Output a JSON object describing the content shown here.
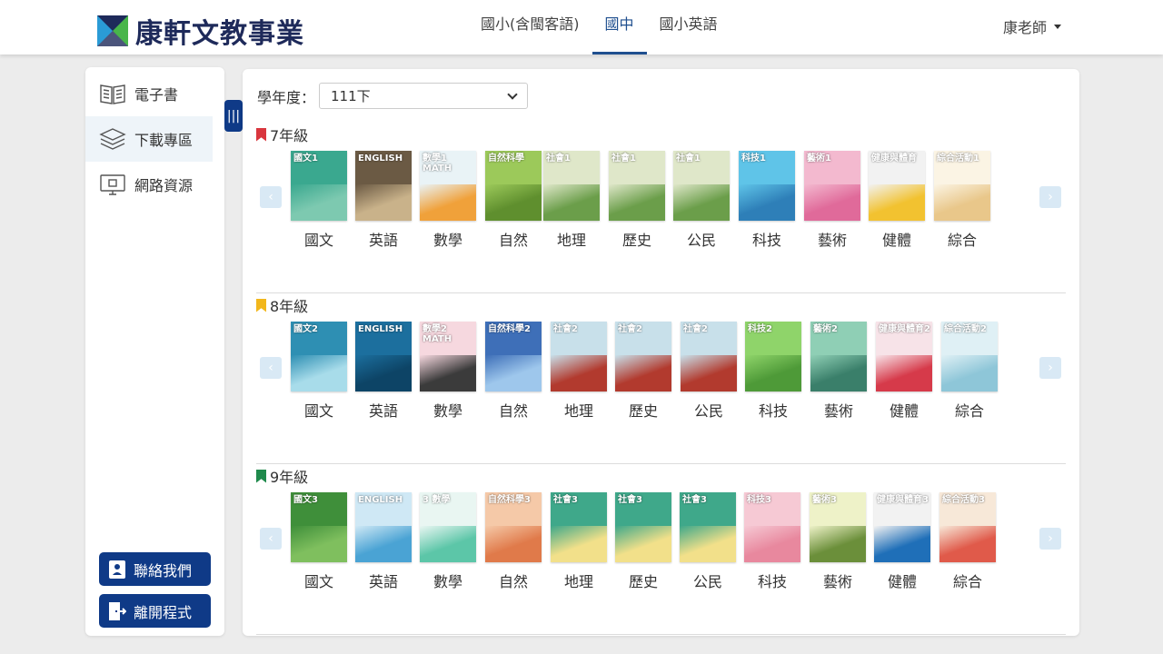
{
  "brand": {
    "name": "康軒文教事業"
  },
  "nav": {
    "items": [
      "國小(含閩客語)",
      "國中",
      "國小英語"
    ],
    "active": 1
  },
  "user": {
    "name": "康老師"
  },
  "sidebar": {
    "items": [
      {
        "label": "電子書",
        "icon": "book-icon"
      },
      {
        "label": "下載專區",
        "icon": "layers-icon"
      },
      {
        "label": "網路資源",
        "icon": "monitor-icon"
      }
    ],
    "active": 1,
    "contact_label": "聯絡我們",
    "exit_label": "離開程式",
    "handle_glyph": "|||"
  },
  "filter": {
    "label": "學年度：",
    "value": "111下"
  },
  "grades": [
    {
      "title": "7年級",
      "color": "#d9363e",
      "books": [
        {
          "label": "國文",
          "cover_text": "國文1",
          "bg": "#3aa88f",
          "art": "#7dc9b0"
        },
        {
          "label": "英語",
          "cover_text": "ENGLISH",
          "bg": "#6b5a44",
          "art": "#c9b28a"
        },
        {
          "label": "數學",
          "cover_text": "數學1 MATH",
          "bg": "#e9f3f6",
          "art": "#f0a13a"
        },
        {
          "label": "自然",
          "cover_text": "自然科學",
          "bg": "#9cc95a",
          "art": "#5f8f2e"
        },
        {
          "label": "地理",
          "cover_text": "社會1",
          "bg": "#dfe7c9",
          "art": "#6b9e4a"
        },
        {
          "label": "歷史",
          "cover_text": "社會1",
          "bg": "#dfe7c9",
          "art": "#6b9e4a"
        },
        {
          "label": "公民",
          "cover_text": "社會1",
          "bg": "#dfe7c9",
          "art": "#6b9e4a"
        },
        {
          "label": "科技",
          "cover_text": "科技1",
          "bg": "#5fc4e8",
          "art": "#2e7fb8"
        },
        {
          "label": "藝術",
          "cover_text": "藝術1",
          "bg": "#f3b9cf",
          "art": "#e06a9a"
        },
        {
          "label": "健體",
          "cover_text": "健康與體育",
          "bg": "#f2f2f2",
          "art": "#f2c230"
        },
        {
          "label": "綜合",
          "cover_text": "綜合活動1",
          "bg": "#fbf4e4",
          "art": "#e9c78a"
        }
      ]
    },
    {
      "title": "8年級",
      "color": "#f2b71c",
      "books": [
        {
          "label": "國文",
          "cover_text": "國文2",
          "bg": "#2e8fb3",
          "art": "#a8dcea"
        },
        {
          "label": "英語",
          "cover_text": "ENGLISH",
          "bg": "#1c6f9e",
          "art": "#0d4466"
        },
        {
          "label": "數學",
          "cover_text": "數學2 MATH",
          "bg": "#f6d8df",
          "art": "#3b3b3b"
        },
        {
          "label": "自然",
          "cover_text": "自然科學2",
          "bg": "#3e6fb8",
          "art": "#9ec7ec"
        },
        {
          "label": "地理",
          "cover_text": "社會2",
          "bg": "#c8e0ea",
          "art": "#b23a2e"
        },
        {
          "label": "歷史",
          "cover_text": "社會2",
          "bg": "#c8e0ea",
          "art": "#b23a2e"
        },
        {
          "label": "公民",
          "cover_text": "社會2",
          "bg": "#c8e0ea",
          "art": "#b23a2e"
        },
        {
          "label": "科技",
          "cover_text": "科技2",
          "bg": "#8fd46a",
          "art": "#4e9a38"
        },
        {
          "label": "藝術",
          "cover_text": "藝術2",
          "bg": "#8fcfb5",
          "art": "#3a7f6a"
        },
        {
          "label": "健體",
          "cover_text": "健康與體育2",
          "bg": "#f7e3e8",
          "art": "#d63a4a"
        },
        {
          "label": "綜合",
          "cover_text": "綜合活動2",
          "bg": "#dff0f5",
          "art": "#8ec6d8"
        }
      ]
    },
    {
      "title": "9年級",
      "color": "#1f8a4c",
      "books": [
        {
          "label": "國文",
          "cover_text": "國文3",
          "bg": "#3f8f3a",
          "art": "#7fbf5e"
        },
        {
          "label": "英語",
          "cover_text": "ENGLISH",
          "bg": "#cfe8f5",
          "art": "#4aa3d4"
        },
        {
          "label": "數學",
          "cover_text": "3 數學",
          "bg": "#e9f6f2",
          "art": "#5cc6a8"
        },
        {
          "label": "自然",
          "cover_text": "自然科學3",
          "bg": "#f5c9a8",
          "art": "#e07a4a"
        },
        {
          "label": "地理",
          "cover_text": "社會3",
          "bg": "#3fa88a",
          "art": "#f2e08a"
        },
        {
          "label": "歷史",
          "cover_text": "社會3",
          "bg": "#3fa88a",
          "art": "#f2e08a"
        },
        {
          "label": "公民",
          "cover_text": "社會3",
          "bg": "#3fa88a",
          "art": "#f2e08a"
        },
        {
          "label": "科技",
          "cover_text": "科技3",
          "bg": "#f6c9d4",
          "art": "#e8889e"
        },
        {
          "label": "藝術",
          "cover_text": "藝術3",
          "bg": "#eef2c8",
          "art": "#6b8f3a"
        },
        {
          "label": "健體",
          "cover_text": "健康與體育3",
          "bg": "#f2f2f2",
          "art": "#1f6fb8"
        },
        {
          "label": "綜合",
          "cover_text": "綜合活動3",
          "bg": "#f7e8d8",
          "art": "#e05a4a"
        }
      ]
    }
  ],
  "colors": {
    "primary": "#0f3a87",
    "active_nav": "#1f4f8f",
    "arrow_bg": "#d9e9f5"
  },
  "icons": {
    "prev": "chevron-left-icon",
    "next": "chevron-right-icon",
    "dropdown": "chevron-down-icon"
  }
}
